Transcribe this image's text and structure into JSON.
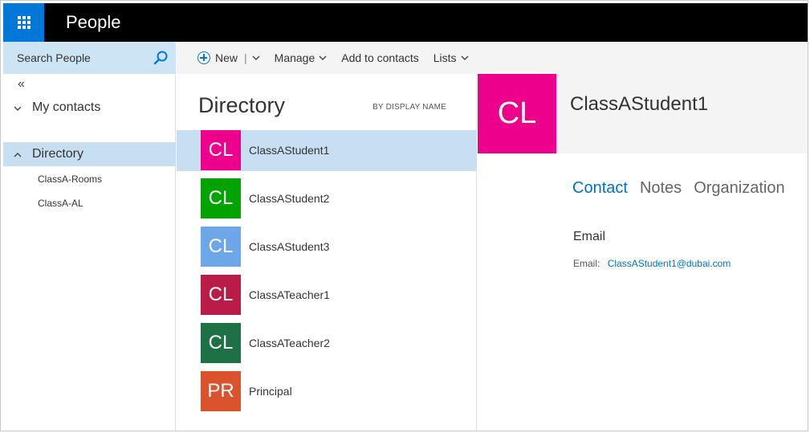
{
  "app": {
    "title": "People",
    "brand_color": "#0078d7"
  },
  "search": {
    "placeholder": "Search People",
    "icon": "search-icon"
  },
  "nav": {
    "collapse_glyph": "«",
    "my_contacts_label": "My contacts",
    "directory_label": "Directory",
    "directory_items": [
      "ClassA-Rooms",
      "ClassA-AL"
    ]
  },
  "toolbar": {
    "new_label": "New",
    "manage_label": "Manage",
    "add_label": "Add to contacts",
    "lists_label": "Lists"
  },
  "list": {
    "title": "Directory",
    "sort_label": "BY DISPLAY NAME",
    "contacts": [
      {
        "initials": "CL",
        "name": "ClassAStudent1",
        "color": "#ec008c",
        "selected": true
      },
      {
        "initials": "CL",
        "name": "ClassAStudent2",
        "color": "#00a300",
        "selected": false
      },
      {
        "initials": "CL",
        "name": "ClassAStudent3",
        "color": "#6ea7e8",
        "selected": false
      },
      {
        "initials": "CL",
        "name": "ClassATeacher1",
        "color": "#b91d47",
        "selected": false
      },
      {
        "initials": "CL",
        "name": "ClassATeacher2",
        "color": "#1e7145",
        "selected": false
      },
      {
        "initials": "PR",
        "name": "Principal",
        "color": "#da532c",
        "selected": false
      }
    ]
  },
  "detail": {
    "initials": "CL",
    "name": "ClassAStudent1",
    "tabs": [
      {
        "label": "Contact",
        "active": true
      },
      {
        "label": "Notes",
        "active": false
      },
      {
        "label": "Organization",
        "active": false
      }
    ],
    "section_title": "Email",
    "email_label": "Email:",
    "email_value": "ClassAStudent1@dubai.com"
  }
}
